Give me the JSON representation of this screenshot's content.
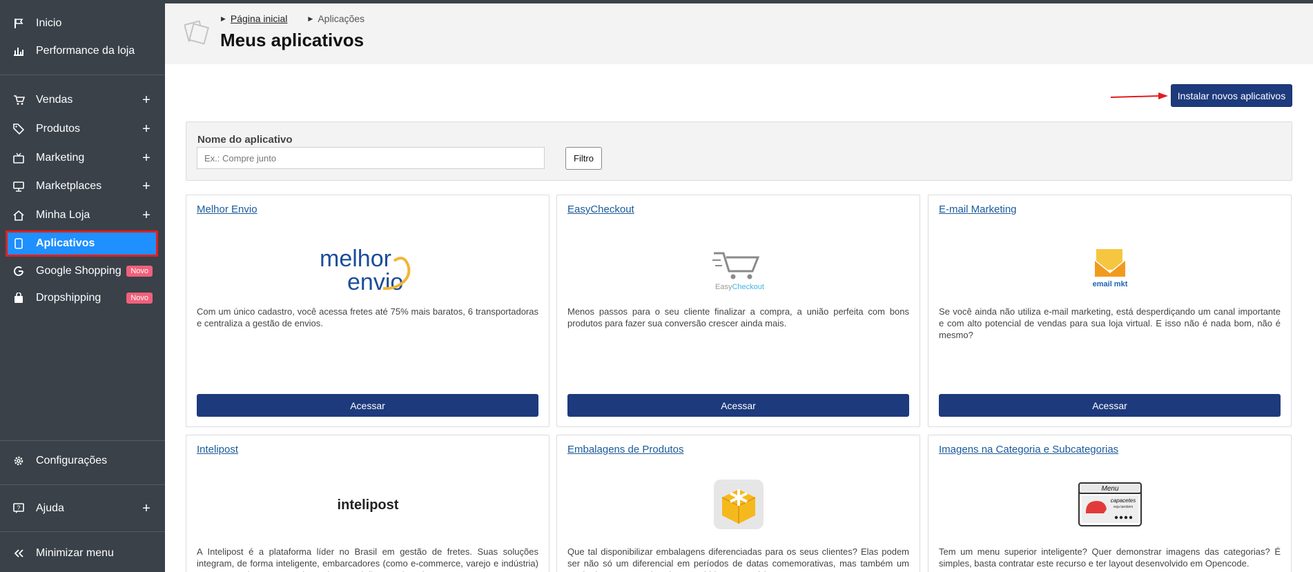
{
  "sidebar": {
    "items": [
      {
        "label": "Inicio",
        "icon": "flag-icon"
      },
      {
        "label": "Performance da loja",
        "icon": "bar-chart-icon"
      },
      {
        "label": "Vendas",
        "icon": "cart-icon",
        "expand": "+"
      },
      {
        "label": "Produtos",
        "icon": "tag-icon",
        "expand": "+"
      },
      {
        "label": "Marketing",
        "icon": "tv-icon",
        "expand": "+"
      },
      {
        "label": "Marketplaces",
        "icon": "monitor-icon",
        "expand": "+"
      },
      {
        "label": "Minha Loja",
        "icon": "home-icon",
        "expand": "+"
      },
      {
        "label": "Aplicativos",
        "icon": "mobile-icon",
        "active": true
      },
      {
        "label": "Google Shopping",
        "icon": "google-icon",
        "badge": "Novo"
      },
      {
        "label": "Dropshipping",
        "icon": "bag-icon",
        "badge": "Novo"
      },
      {
        "label": "Configurações",
        "icon": "gear-icon"
      },
      {
        "label": "Ajuda",
        "icon": "help-icon",
        "expand": "+"
      },
      {
        "label": "Minimizar menu",
        "icon": "double-chevron-left-icon"
      }
    ],
    "active_color": "#1e90ff",
    "highlight_color": "#e02020"
  },
  "breadcrumb": {
    "home": "Página inicial",
    "current": "Aplicações"
  },
  "page_title": "Meus aplicativos",
  "install_button": "Instalar novos aplicativos",
  "filter": {
    "label": "Nome do aplicativo",
    "placeholder": "Ex.: Compre junto",
    "button": "Filtro"
  },
  "cards": [
    {
      "title": "Melhor Envio",
      "logo": "melhor-envio-logo",
      "desc": "Com um único cadastro, você acessa fretes até 75% mais baratos, 6 transportadoras e centraliza a gestão de envios.",
      "button": "Acessar",
      "logo_text": [
        "melhor",
        "envio"
      ]
    },
    {
      "title": "EasyCheckout",
      "logo": "easycheckout-logo",
      "desc": "Menos passos para o seu cliente finalizar a compra, a união perfeita com bons produtos para fazer sua conversão crescer ainda mais.",
      "button": "Acessar",
      "logo_text": [
        "Easy",
        "Checkout"
      ]
    },
    {
      "title": "E-mail Marketing",
      "logo": "email-mkt-logo",
      "desc": "Se você ainda não utiliza e-mail marketing, está desperdiçando um canal importante e com alto potencial de vendas para sua loja virtual. E isso não é nada bom, não é mesmo?",
      "button": "Acessar",
      "logo_text": [
        "email mkt"
      ]
    },
    {
      "title": "Intelipost",
      "logo": "intelipost-logo",
      "desc": "A Intelipost é a plataforma líder no Brasil em gestão de fretes. Suas soluções integram, de forma inteligente, embarcadores (como e-commerce, varejo e indústria) e transportadoras, proporcionando uma visão completa das",
      "button": "Acessar",
      "logo_text": [
        "intelipost"
      ]
    },
    {
      "title": "Embalagens de Produtos",
      "logo": "gift-box-logo",
      "desc": "Que tal disponibilizar embalagens diferenciadas para os seus clientes? Elas podem ser não só um diferencial em períodos de datas comemorativas, mas também um modo de agregar mais valor percebido e monetário aos seus",
      "button": "Acessar",
      "logo_text": []
    },
    {
      "title": "Imagens na Categoria e Subcategorias",
      "logo": "category-menu-logo",
      "desc": "Tem um menu superior inteligente? Quer demonstrar imagens das categorias? É simples, basta contratar este recurso e ter layout desenvolvido em Opencode.",
      "button": "Acessar",
      "logo_text": [
        "Menu",
        "capacetes",
        "veja também"
      ]
    }
  ]
}
